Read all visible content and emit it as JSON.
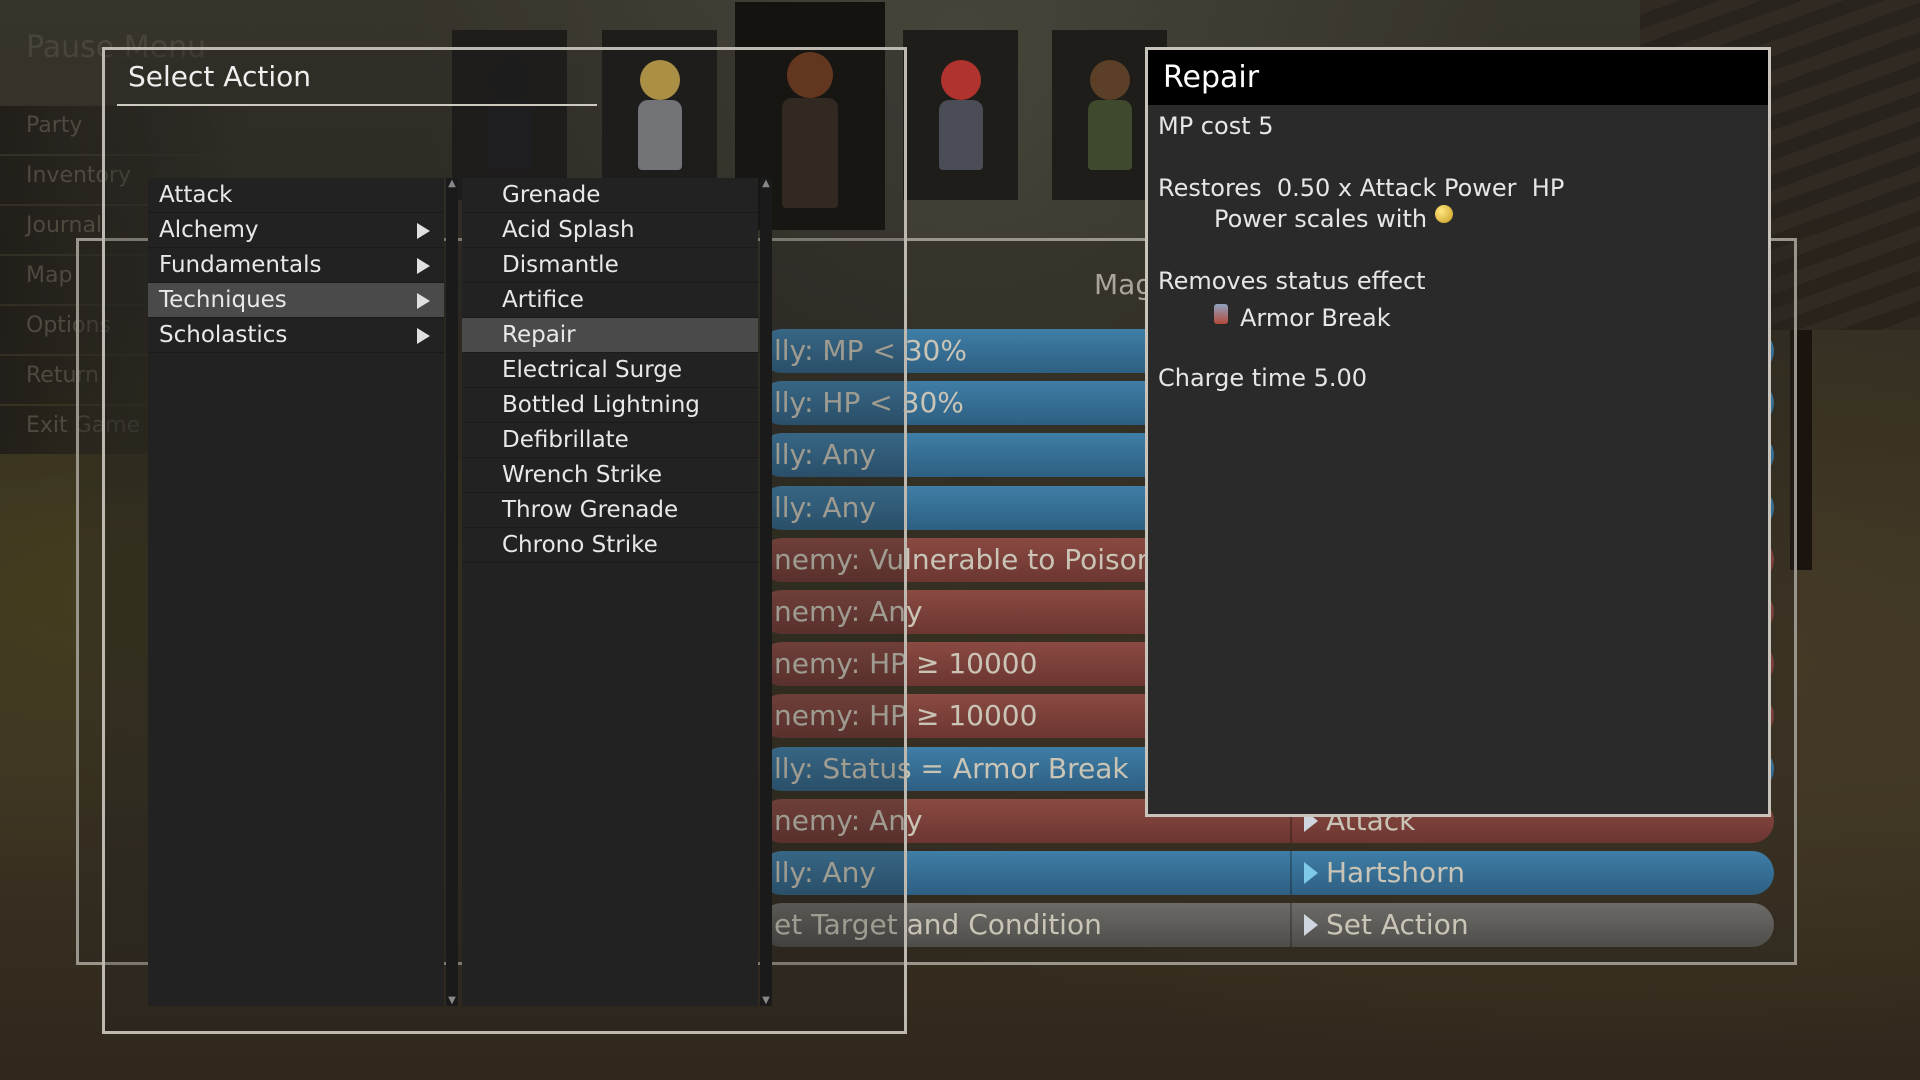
{
  "pause_menu": {
    "title": "Pause Menu",
    "items": [
      "Party",
      "Inventory",
      "Journal",
      "Map",
      "Options",
      "Return",
      "Exit Game"
    ]
  },
  "tactics": {
    "header": "Mag",
    "rows": [
      {
        "target": "lly: MP < 30%",
        "action": "",
        "kind": "ally"
      },
      {
        "target": "lly: HP < 30%",
        "action": "",
        "kind": "ally"
      },
      {
        "target": "lly: Any",
        "action": "",
        "kind": "ally"
      },
      {
        "target": "lly: Any",
        "action": "",
        "kind": "ally"
      },
      {
        "target": "nemy: Vulnerable to Poison",
        "action": "",
        "kind": "enemy"
      },
      {
        "target": "nemy: Any",
        "action": "",
        "kind": "enemy"
      },
      {
        "target": "nemy: HP ≥ 10000",
        "action": "",
        "kind": "enemy"
      },
      {
        "target": "nemy: HP ≥ 10000",
        "action": "",
        "kind": "enemy"
      },
      {
        "target": "lly: Status = Armor Break",
        "action": "",
        "kind": "ally"
      },
      {
        "target": "nemy: Any",
        "action": "Attack",
        "kind": "enemy"
      },
      {
        "target": "lly: Any",
        "action": "Hartshorn",
        "kind": "ally"
      },
      {
        "target": "et Target and Condition",
        "action": "Set Action",
        "kind": "gray"
      }
    ]
  },
  "select_action": {
    "title": "Select Action",
    "categories": [
      {
        "label": "Attack",
        "submenu": false
      },
      {
        "label": "Alchemy",
        "submenu": true
      },
      {
        "label": "Fundamentals",
        "submenu": true
      },
      {
        "label": "Techniques",
        "submenu": true
      },
      {
        "label": "Scholastics",
        "submenu": true
      }
    ],
    "selected_category": "Techniques",
    "techniques": [
      "Grenade",
      "Acid Splash",
      "Dismantle",
      "Artifice",
      "Repair",
      "Electrical Surge",
      "Bottled Lightning",
      "Defibrillate",
      "Wrench Strike",
      "Throw Grenade",
      "Chrono Strike"
    ],
    "selected_technique": "Repair"
  },
  "info": {
    "title": "Repair",
    "mp_cost": "MP cost 5",
    "restores": "Restores  0.50 x Attack Power  HP",
    "scales": "Power scales with",
    "removes": "Removes status effect",
    "status": "Armor Break",
    "charge": "Charge time 5.00"
  },
  "colors": {
    "ally_row": "#3f7ea6",
    "enemy_row": "#8a4a42",
    "selection": "#4a4a4a",
    "panel": "#222222"
  }
}
